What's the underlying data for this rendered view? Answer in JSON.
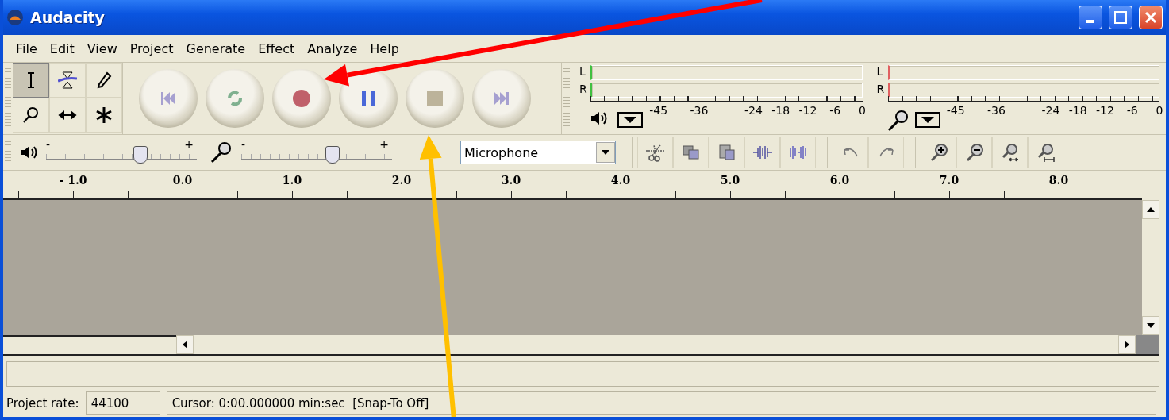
{
  "window": {
    "title": "Audacity"
  },
  "menu": [
    "File",
    "Edit",
    "View",
    "Project",
    "Generate",
    "Effect",
    "Analyze",
    "Help"
  ],
  "tools": [
    {
      "kind": "select",
      "selected": true
    },
    {
      "kind": "envelope",
      "selected": false
    },
    {
      "kind": "draw",
      "selected": false
    },
    {
      "kind": "zoom",
      "selected": false
    },
    {
      "kind": "timeshift",
      "selected": false
    },
    {
      "kind": "multi",
      "selected": false
    }
  ],
  "transport": [
    {
      "kind": "skip-start"
    },
    {
      "kind": "loop"
    },
    {
      "kind": "record"
    },
    {
      "kind": "pause"
    },
    {
      "kind": "stop"
    },
    {
      "kind": "skip-end"
    }
  ],
  "meters": [
    {
      "kind": "playback",
      "channels": [
        "L",
        "R"
      ],
      "ticks": [
        "-45",
        "-36",
        "-24",
        "-18",
        "-12",
        "-6",
        "0"
      ]
    },
    {
      "kind": "record",
      "channels": [
        "L",
        "R"
      ],
      "ticks": [
        "-45",
        "-36",
        "-24",
        "-18",
        "-12",
        "-6",
        "0"
      ]
    }
  ],
  "mixer": [
    {
      "kind": "playback",
      "minus": "-",
      "plus": "+",
      "level": 0.62
    },
    {
      "kind": "record",
      "minus": "-",
      "plus": "+",
      "level": 0.6
    }
  ],
  "input_source": {
    "value": "Microphone"
  },
  "edit_tools": [
    {
      "kind": "cut"
    },
    {
      "kind": "copy"
    },
    {
      "kind": "paste"
    },
    {
      "kind": "trim"
    },
    {
      "kind": "silence"
    }
  ],
  "history_tools": [
    {
      "kind": "undo"
    },
    {
      "kind": "redo"
    }
  ],
  "zoom_tools": [
    {
      "kind": "zoom-in"
    },
    {
      "kind": "zoom-out"
    },
    {
      "kind": "fit-selection"
    },
    {
      "kind": "fit-project"
    }
  ],
  "ruler": {
    "labels": [
      "- 1.0",
      "0.0",
      "1.0",
      "2.0",
      "3.0",
      "4.0",
      "5.0",
      "6.0",
      "7.0",
      "8.0"
    ]
  },
  "status": {
    "rate_label": "Project rate:",
    "rate": "44100",
    "cursor": "Cursor: 0:00.000000 min:sec",
    "snap": "[Snap-To Off]"
  },
  "annotations": [
    {
      "color": "#ff0000"
    },
    {
      "color": "#ffc000"
    }
  ]
}
